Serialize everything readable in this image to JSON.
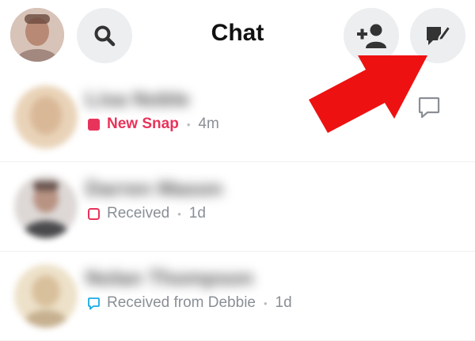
{
  "header": {
    "title": "Chat"
  },
  "chats": [
    {
      "name": "Lisa Noble",
      "status": "New Snap",
      "time": "4m",
      "status_type": "new-snap",
      "status_color": "#e8335a"
    },
    {
      "name": "Darren Mason",
      "status": "Received",
      "time": "1d",
      "status_type": "received-snap",
      "status_color": "#e8335a"
    },
    {
      "name": "Nolan Thompson",
      "status": "Received from Debbie",
      "time": "1d",
      "status_type": "received-chat",
      "status_color": "#1aa7e6"
    }
  ],
  "icons": {
    "search": "search-icon",
    "add_friend": "add-friend-icon",
    "new_chat": "new-chat-icon",
    "reply": "chat-bubble-icon"
  },
  "colors": {
    "accent_red": "#e8335a",
    "accent_blue": "#1aa7e6",
    "arrow_red": "#ee1111",
    "button_bg": "#eceef0"
  }
}
